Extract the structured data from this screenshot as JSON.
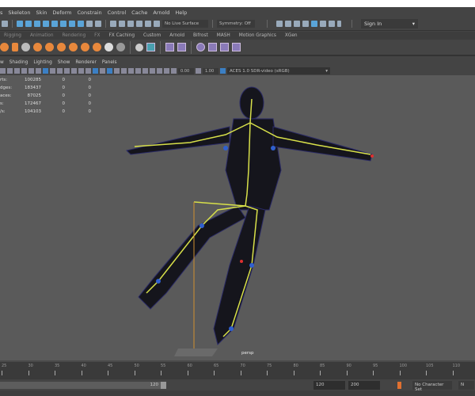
{
  "menu": [
    "s",
    "Skeleton",
    "Skin",
    "Deform",
    "Constrain",
    "Control",
    "Cache",
    "Arnold",
    "Help"
  ],
  "toolbar": {
    "live_surface": "No Live Surface",
    "symmetry": "Symmetry: Off",
    "sign_in": "Sign In"
  },
  "shelf_tabs": [
    "Rigging",
    "Animation",
    "Rendering",
    "FX",
    "FX Caching",
    "Custom",
    "Arnold",
    "Bifrost",
    "MASH",
    "Motion Graphics",
    "XGen"
  ],
  "panel_menu": [
    "w",
    "Shading",
    "Lighting",
    "Show",
    "Renderer",
    "Panels"
  ],
  "panel_toolbar": {
    "exposure": "0.00",
    "gamma": "1.00",
    "color_space": "ACES 1.0 SDR-video (sRGB)"
  },
  "stats": [
    {
      "label": "rts:",
      "v": "100285",
      "a": "0",
      "b": "0"
    },
    {
      "label": "dges:",
      "v": "183437",
      "a": "0",
      "b": "0"
    },
    {
      "label": "aces:",
      "v": "87025",
      "a": "0",
      "b": "0"
    },
    {
      "label": "s:",
      "v": "172467",
      "a": "0",
      "b": "0"
    },
    {
      "label": "/s:",
      "v": "104103",
      "a": "0",
      "b": "0"
    }
  ],
  "camera": "persp",
  "timeline_ticks": [
    "25",
    "30",
    "35",
    "40",
    "45",
    "50",
    "55",
    "60",
    "65",
    "70",
    "75",
    "80",
    "85",
    "90",
    "95",
    "100",
    "105",
    "110"
  ],
  "range": {
    "slider_end": "120",
    "end": "120",
    "max": "200",
    "character_set": "No Character Set",
    "extra": "N"
  },
  "colors": {
    "accent": "#5aa4d8",
    "skeleton": "#d8e04a",
    "viewport": "#5a5a5a"
  }
}
